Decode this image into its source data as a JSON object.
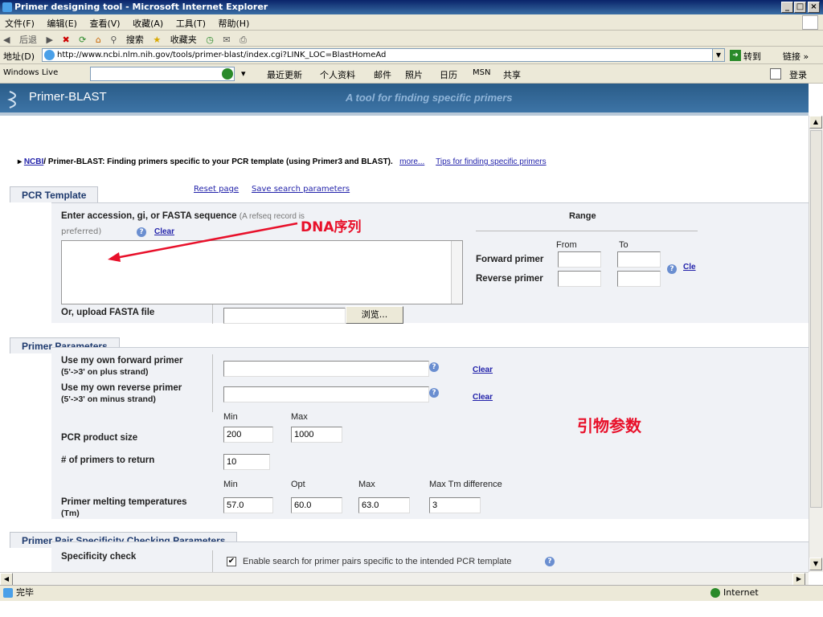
{
  "window": {
    "title": "Primer designing tool - Microsoft Internet Explorer"
  },
  "menu": [
    "文件(F)",
    "编辑(E)",
    "查看(V)",
    "收藏(A)",
    "工具(T)",
    "帮助(H)"
  ],
  "toolbar": {
    "back": "后退",
    "search": "搜索",
    "favorites": "收藏夹"
  },
  "address": {
    "label": "地址(D)",
    "url": "http://www.ncbi.nlm.nih.gov/tools/primer-blast/index.cgi?LINK_LOC=BlastHomeAd",
    "go": "转到",
    "links": "链接 »"
  },
  "live": {
    "brand": "Windows Live",
    "items": [
      "最近更新",
      "个人资料",
      "邮件",
      "照片",
      "日历",
      "MSN",
      "共享"
    ],
    "login": "登录"
  },
  "banner": {
    "title": "Primer-BLAST",
    "tagline": "A tool for finding specific primers"
  },
  "breadcrumb": {
    "ncbi": "NCBI",
    "sep": "/",
    "text": "Primer-BLAST: Finding primers specific to your PCR template (using Primer3 and BLAST).",
    "more": "more...",
    "tips": "Tips for finding specific primers"
  },
  "pcr": {
    "tab": "PCR Template",
    "reset": "Reset page",
    "save": "Save search parameters",
    "enter_label": "Enter accession, gi, or FASTA sequence",
    "enter_note": "(A refseq record is",
    "enter_note2": "preferred)",
    "clear": "Clear",
    "range": "Range",
    "from": "From",
    "to": "To",
    "forward": "Forward primer",
    "reverse": "Reverse primer",
    "range_clear": "Cle",
    "upload": "Or, upload FASTA file",
    "browse": "浏览..."
  },
  "annotations": {
    "dna": "DNA序列",
    "params": "引物参数"
  },
  "params": {
    "tab": "Primer Parameters",
    "fwd_label": "Use my own forward primer",
    "fwd_sub": "(5'->3' on plus strand)",
    "rev_label": "Use my own reverse primer",
    "rev_sub": "(5'->3' on minus strand)",
    "clear": "Clear",
    "min": "Min",
    "max": "Max",
    "opt": "Opt",
    "maxdiff": "Max Tm difference",
    "product_label": "PCR product size",
    "product_min": "200",
    "product_max": "1000",
    "num_label": "# of primers to return",
    "num_value": "10",
    "tm_label": "Primer melting temperatures",
    "tm_sub": "(Tm)",
    "tm_min": "57.0",
    "tm_opt": "60.0",
    "tm_max": "63.0",
    "tm_diff": "3"
  },
  "specificity": {
    "tab": "Primer Pair Specificity Checking Parameters",
    "label": "Specificity check",
    "check_text": "Enable search for primer pairs specific to the intended PCR template"
  },
  "status": {
    "text": "完毕",
    "zone": "Internet"
  }
}
